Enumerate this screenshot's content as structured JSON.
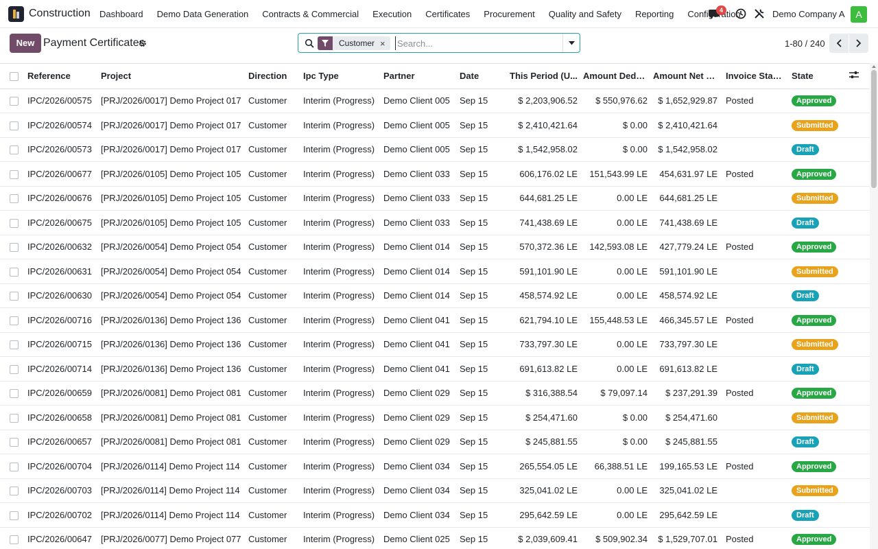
{
  "app": {
    "name": "Construction"
  },
  "menu": [
    "Dashboard",
    "Demo Data Generation",
    "Contracts & Commercial",
    "Execution",
    "Certificates",
    "Procurement",
    "Quality and Safety",
    "Reporting",
    "Configuration"
  ],
  "topbar": {
    "notification_count": "4",
    "company": "Demo Company A",
    "avatar_letter": "A"
  },
  "control": {
    "new_label": "New",
    "title": "Payment Certificates"
  },
  "search": {
    "facet_label": "Customer",
    "facet_close": "×",
    "placeholder": "Search..."
  },
  "pager": {
    "text": "1-80 / 240"
  },
  "table": {
    "headers": [
      "Reference",
      "Project",
      "Direction",
      "Ipc Type",
      "Partner",
      "Date",
      "This Period (U...",
      "Amount Dedu...",
      "Amount Net P...",
      "Invoice Status",
      "State"
    ],
    "rows": [
      [
        "IPC/2026/00575",
        "[PRJ/2026/0017] Demo Project 017",
        "Customer",
        "Interim (Progress)",
        "Demo Client 005",
        "Sep 15",
        "$ 2,203,906.52",
        "$ 550,976.62",
        "$ 1,652,929.87",
        "Posted",
        "Approved"
      ],
      [
        "IPC/2026/00574",
        "[PRJ/2026/0017] Demo Project 017",
        "Customer",
        "Interim (Progress)",
        "Demo Client 005",
        "Sep 15",
        "$ 2,410,421.64",
        "$ 0.00",
        "$ 2,410,421.64",
        "",
        "Submitted"
      ],
      [
        "IPC/2026/00573",
        "[PRJ/2026/0017] Demo Project 017",
        "Customer",
        "Interim (Progress)",
        "Demo Client 005",
        "Sep 15",
        "$ 1,542,958.02",
        "$ 0.00",
        "$ 1,542,958.02",
        "",
        "Draft"
      ],
      [
        "IPC/2026/00677",
        "[PRJ/2026/0105] Demo Project 105",
        "Customer",
        "Interim (Progress)",
        "Demo Client 033",
        "Sep 15",
        "606,176.02 LE",
        "151,543.99 LE",
        "454,631.97 LE",
        "Posted",
        "Approved"
      ],
      [
        "IPC/2026/00676",
        "[PRJ/2026/0105] Demo Project 105",
        "Customer",
        "Interim (Progress)",
        "Demo Client 033",
        "Sep 15",
        "644,681.25 LE",
        "0.00 LE",
        "644,681.25 LE",
        "",
        "Submitted"
      ],
      [
        "IPC/2026/00675",
        "[PRJ/2026/0105] Demo Project 105",
        "Customer",
        "Interim (Progress)",
        "Demo Client 033",
        "Sep 15",
        "741,438.69 LE",
        "0.00 LE",
        "741,438.69 LE",
        "",
        "Draft"
      ],
      [
        "IPC/2026/00632",
        "[PRJ/2026/0054] Demo Project 054",
        "Customer",
        "Interim (Progress)",
        "Demo Client 014",
        "Sep 15",
        "570,372.36 LE",
        "142,593.08 LE",
        "427,779.24 LE",
        "Posted",
        "Approved"
      ],
      [
        "IPC/2026/00631",
        "[PRJ/2026/0054] Demo Project 054",
        "Customer",
        "Interim (Progress)",
        "Demo Client 014",
        "Sep 15",
        "591,101.90 LE",
        "0.00 LE",
        "591,101.90 LE",
        "",
        "Submitted"
      ],
      [
        "IPC/2026/00630",
        "[PRJ/2026/0054] Demo Project 054",
        "Customer",
        "Interim (Progress)",
        "Demo Client 014",
        "Sep 15",
        "458,574.92 LE",
        "0.00 LE",
        "458,574.92 LE",
        "",
        "Draft"
      ],
      [
        "IPC/2026/00716",
        "[PRJ/2026/0136] Demo Project 136",
        "Customer",
        "Interim (Progress)",
        "Demo Client 041",
        "Sep 15",
        "621,794.10 LE",
        "155,448.53 LE",
        "466,345.57 LE",
        "Posted",
        "Approved"
      ],
      [
        "IPC/2026/00715",
        "[PRJ/2026/0136] Demo Project 136",
        "Customer",
        "Interim (Progress)",
        "Demo Client 041",
        "Sep 15",
        "733,797.30 LE",
        "0.00 LE",
        "733,797.30 LE",
        "",
        "Submitted"
      ],
      [
        "IPC/2026/00714",
        "[PRJ/2026/0136] Demo Project 136",
        "Customer",
        "Interim (Progress)",
        "Demo Client 041",
        "Sep 15",
        "691,613.82 LE",
        "0.00 LE",
        "691,613.82 LE",
        "",
        "Draft"
      ],
      [
        "IPC/2026/00659",
        "[PRJ/2026/0081] Demo Project 081",
        "Customer",
        "Interim (Progress)",
        "Demo Client 029",
        "Sep 15",
        "$ 316,388.54",
        "$ 79,097.14",
        "$ 237,291.39",
        "Posted",
        "Approved"
      ],
      [
        "IPC/2026/00658",
        "[PRJ/2026/0081] Demo Project 081",
        "Customer",
        "Interim (Progress)",
        "Demo Client 029",
        "Sep 15",
        "$ 254,471.60",
        "$ 0.00",
        "$ 254,471.60",
        "",
        "Submitted"
      ],
      [
        "IPC/2026/00657",
        "[PRJ/2026/0081] Demo Project 081",
        "Customer",
        "Interim (Progress)",
        "Demo Client 029",
        "Sep 15",
        "$ 245,881.55",
        "$ 0.00",
        "$ 245,881.55",
        "",
        "Draft"
      ],
      [
        "IPC/2026/00704",
        "[PRJ/2026/0114] Demo Project 114",
        "Customer",
        "Interim (Progress)",
        "Demo Client 034",
        "Sep 15",
        "265,554.05 LE",
        "66,388.51 LE",
        "199,165.53 LE",
        "Posted",
        "Approved"
      ],
      [
        "IPC/2026/00703",
        "[PRJ/2026/0114] Demo Project 114",
        "Customer",
        "Interim (Progress)",
        "Demo Client 034",
        "Sep 15",
        "325,041.02 LE",
        "0.00 LE",
        "325,041.02 LE",
        "",
        "Submitted"
      ],
      [
        "IPC/2026/00702",
        "[PRJ/2026/0114] Demo Project 114",
        "Customer",
        "Interim (Progress)",
        "Demo Client 034",
        "Sep 15",
        "295,642.59 LE",
        "0.00 LE",
        "295,642.59 LE",
        "",
        "Draft"
      ],
      [
        "IPC/2026/00647",
        "[PRJ/2026/0077] Demo Project 077",
        "Customer",
        "Interim (Progress)",
        "Demo Client 025",
        "Sep 15",
        "$ 2,039,609.41",
        "$ 509,902.34",
        "$ 1,529,707.01",
        "Posted",
        "Approved"
      ]
    ]
  },
  "colors": {
    "brand": "#714b67",
    "approved": "#28a745",
    "submitted": "#e9a21b",
    "draft": "#17a2b8",
    "search_border": "#29a0a9"
  },
  "icons": {
    "chat": "chat-icon",
    "clock": "clock-icon",
    "tools": "tools-icon",
    "gear": "gear-icon",
    "search": "search-icon",
    "filter": "filter-icon",
    "optional_columns": "sliders-icon"
  }
}
